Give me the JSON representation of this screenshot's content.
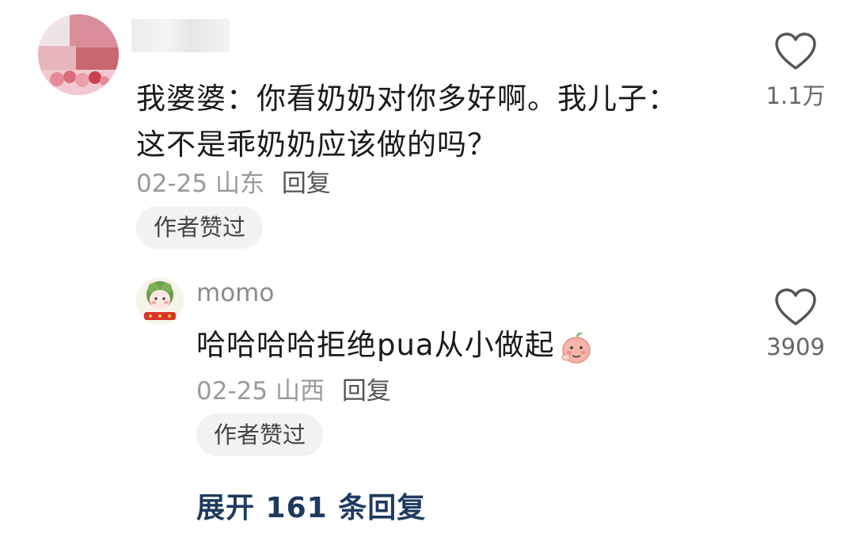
{
  "comments": [
    {
      "text": "我婆婆：你看奶奶对你多好啊。我儿子：这不是乖奶奶应该做的吗？",
      "date": "02-25",
      "location": "山东",
      "reply_label": "回复",
      "author_liked": "作者赞过",
      "like_count": "1.1万",
      "avatar_icon": "rose-avatar-blurred",
      "username_blurred": true
    }
  ],
  "reply": {
    "username": "momo",
    "text": "哈哈哈哈拒绝pua从小做起",
    "emoji_icon": "peach-emoji-icon",
    "date": "02-25",
    "location": "山西",
    "reply_label": "回复",
    "author_liked": "作者赞过",
    "like_count": "3909",
    "avatar_icon": "cartoon-avatar"
  },
  "expand_label": "展开 161 条回复",
  "colors": {
    "accent_link": "#1e3a5f",
    "meta_gray": "#9a9a9a",
    "badge_bg": "#f2f2f2"
  }
}
